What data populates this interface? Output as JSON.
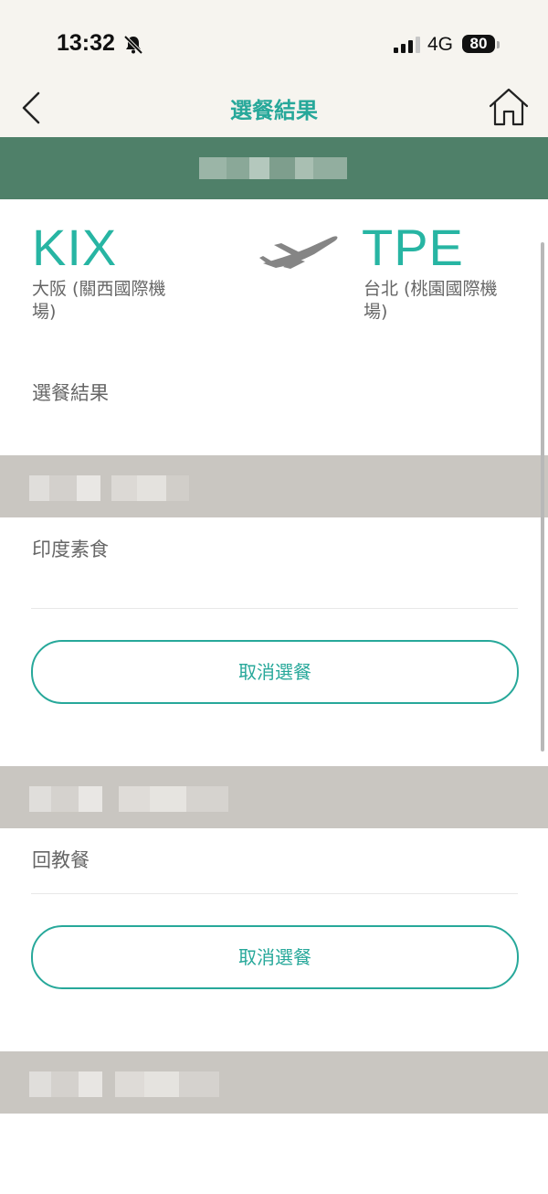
{
  "status_bar": {
    "time": "13:32",
    "network": "4G",
    "battery": "80"
  },
  "nav": {
    "title": "選餐結果",
    "back_icon": "chevron-left-icon",
    "home_icon": "home-icon"
  },
  "route": {
    "origin_code": "KIX",
    "origin_city": "大阪 (關西國際機場)",
    "dest_code": "TPE",
    "dest_city": "台北 (桃園國際機場)",
    "plane_icon": "airplane-takeoff-icon"
  },
  "section_title": "選餐結果",
  "passengers": [
    {
      "meal": "印度素食",
      "cancel_label": "取消選餐"
    },
    {
      "meal": "回教餐",
      "cancel_label": "取消選餐"
    }
  ],
  "colors": {
    "accent": "#27a89a",
    "banner": "#4f8069",
    "passenger_bar": "#c9c6c1",
    "header_bg": "#f6f4ef"
  }
}
